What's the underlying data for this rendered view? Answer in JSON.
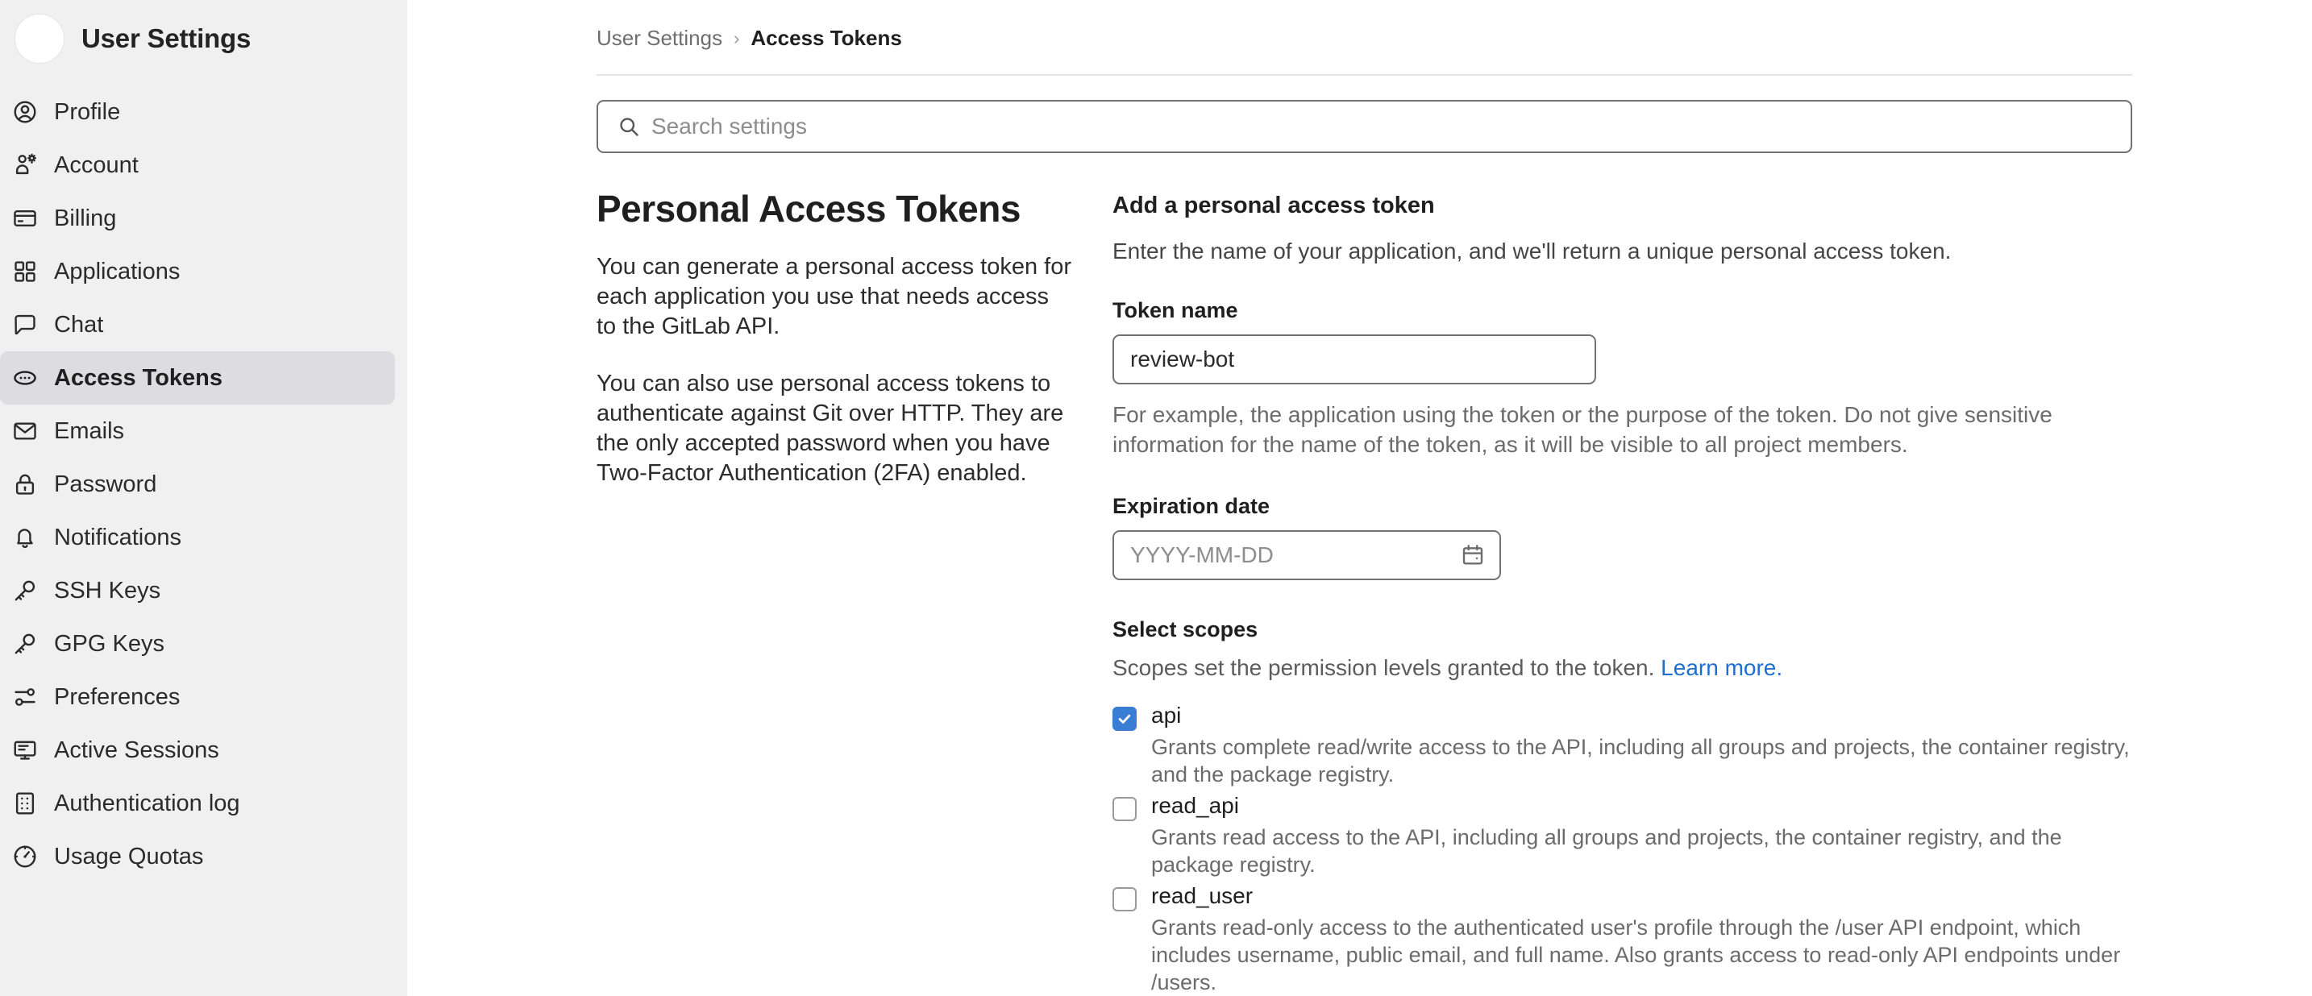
{
  "sidebar": {
    "title": "User Settings",
    "avatar_alt": "user-avatar",
    "items": [
      {
        "label": "Profile",
        "icon": "profile-icon",
        "active": false
      },
      {
        "label": "Account",
        "icon": "account-icon",
        "active": false
      },
      {
        "label": "Billing",
        "icon": "credit-card-icon",
        "active": false
      },
      {
        "label": "Applications",
        "icon": "applications-grid-icon",
        "active": false
      },
      {
        "label": "Chat",
        "icon": "chat-bubble-icon",
        "active": false
      },
      {
        "label": "Access Tokens",
        "icon": "token-icon",
        "active": true
      },
      {
        "label": "Emails",
        "icon": "envelope-icon",
        "active": false
      },
      {
        "label": "Password",
        "icon": "lock-icon",
        "active": false
      },
      {
        "label": "Notifications",
        "icon": "bell-icon",
        "active": false
      },
      {
        "label": "SSH Keys",
        "icon": "key-icon",
        "active": false
      },
      {
        "label": "GPG Keys",
        "icon": "key-icon",
        "active": false
      },
      {
        "label": "Preferences",
        "icon": "sliders-icon",
        "active": false
      },
      {
        "label": "Active Sessions",
        "icon": "monitor-icon",
        "active": false
      },
      {
        "label": "Authentication log",
        "icon": "log-list-icon",
        "active": false
      },
      {
        "label": "Usage Quotas",
        "icon": "gauge-icon",
        "active": false
      }
    ]
  },
  "breadcrumb": {
    "parent": "User Settings",
    "separator": "›",
    "current": "Access Tokens"
  },
  "search": {
    "placeholder": "Search settings",
    "value": "",
    "icon": "search-icon"
  },
  "intro": {
    "title": "Personal Access Tokens",
    "paragraph_1": "You can generate a personal access token for each application you use that needs access to the GitLab API.",
    "paragraph_2": "You can also use personal access tokens to authenticate against Git over HTTP. They are the only accepted password when you have Two-Factor Authentication (2FA) enabled."
  },
  "form": {
    "title": "Add a personal access token",
    "subtitle": "Enter the name of your application, and we'll return a unique personal access token.",
    "token_name_label": "Token name",
    "token_name_value": "review-bot",
    "token_name_placeholder": "",
    "token_name_help": "For example, the application using the token or the purpose of the token. Do not give sensitive information for the name of the token, as it will be visible to all project members.",
    "expiration_label": "Expiration date",
    "expiration_value": "",
    "expiration_placeholder": "YYYY-MM-DD",
    "calendar_icon": "calendar-icon"
  },
  "scopes": {
    "title": "Select scopes",
    "subtitle": "Scopes set the permission levels granted to the token.",
    "learn_more": "Learn more.",
    "items": [
      {
        "name": "api",
        "checked": true,
        "description": "Grants complete read/write access to the API, including all groups and projects, the container registry, and the package registry."
      },
      {
        "name": "read_api",
        "checked": false,
        "description": "Grants read access to the API, including all groups and projects, the container registry, and the package registry."
      },
      {
        "name": "read_user",
        "checked": false,
        "description": "Grants read-only access to the authenticated user's profile through the /user API endpoint, which includes username, public email, and full name. Also grants access to read-only API endpoints under /users."
      }
    ]
  },
  "colors": {
    "sidebar_bg": "#f0f0f0",
    "active_item_bg": "#dcdce1",
    "link_blue": "#1f6fd0",
    "checkbox_blue": "#3a7dd4",
    "text_primary": "#1f1f1f",
    "text_muted": "#6b6b6b"
  }
}
